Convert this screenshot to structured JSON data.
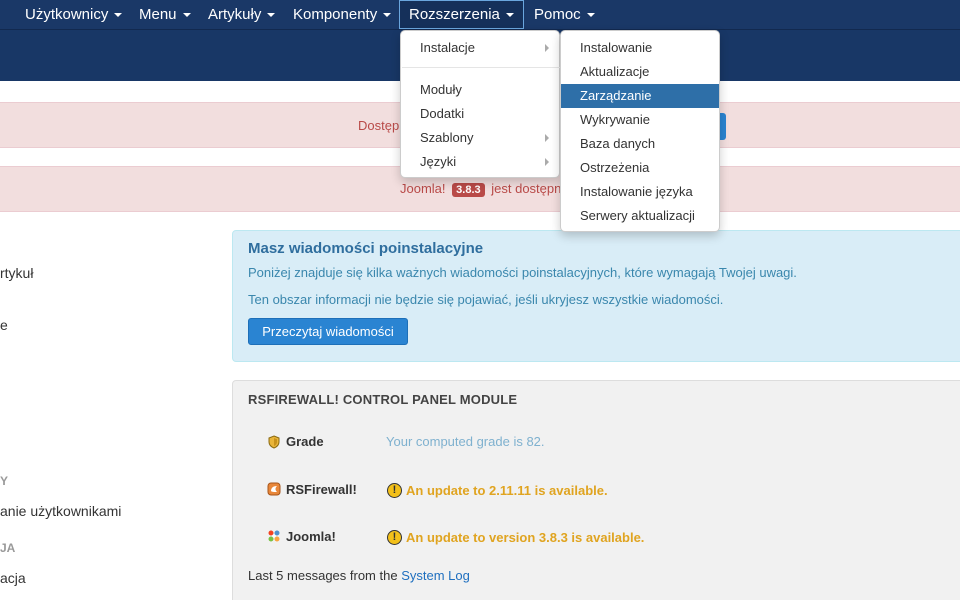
{
  "navbar": {
    "items": [
      {
        "label": "Użytkownicy"
      },
      {
        "label": "Menu"
      },
      {
        "label": "Artykuły"
      },
      {
        "label": "Komponenty"
      },
      {
        "label": "Rozszerzenia"
      },
      {
        "label": "Pomoc"
      }
    ]
  },
  "alerts": {
    "first_text": "Dostęp",
    "second_prefix": "Joomla!",
    "second_version": "3.8.3",
    "second_suffix": "jest dostępny"
  },
  "sidebar": {
    "item1": "rtykuł",
    "item2": "e",
    "head1": "Y",
    "item3": "anie użytkownikami",
    "head2": "JA",
    "item4": "acja"
  },
  "postinstall": {
    "title": "Masz wiadomości poinstalacyjne",
    "p1": "Poniżej znajduje się kilka ważnych wiadomości poinstalacyjnych, które wymagają Twojej uwagi.",
    "p2": "Ten obszar informacji nie będzie się pojawiać, jeśli ukryjesz wszystkie wiadomości.",
    "button": "Przeczytaj wiadomości"
  },
  "rsfirewall": {
    "title": "RSFIREWALL! CONTROL PANEL MODULE",
    "grade_label": "Grade",
    "grade_value": "Your computed grade is 82.",
    "rs_label": "RSFirewall!",
    "rs_update": "An update to 2.11.11 is available.",
    "joomla_label": "Joomla!",
    "joomla_update": "An update to version 3.8.3 is available.",
    "log_prefix": "Last 5 messages from the ",
    "log_link": "System Log",
    "warn_glyph": "!"
  },
  "menu_main": {
    "items": [
      {
        "label": "Instalacje"
      },
      {
        "label": "Moduły"
      },
      {
        "label": "Dodatki"
      },
      {
        "label": "Szablony"
      },
      {
        "label": "Języki"
      }
    ]
  },
  "menu_sub": {
    "items": [
      {
        "label": "Instalowanie"
      },
      {
        "label": "Aktualizacje"
      },
      {
        "label": "Zarządzanie"
      },
      {
        "label": "Wykrywanie"
      },
      {
        "label": "Baza danych"
      },
      {
        "label": "Ostrzeżenia"
      },
      {
        "label": "Instalowanie języka"
      },
      {
        "label": "Serwery aktualizacji"
      }
    ],
    "highlighted": "Zarządzanie"
  },
  "colors": {
    "navbar": "#1a3867",
    "accent": "#2a84d2",
    "highlight": "#2e6fa8",
    "alert_bg": "#f2dede",
    "info_bg": "#d9edf7",
    "warning": "#e0a420"
  }
}
